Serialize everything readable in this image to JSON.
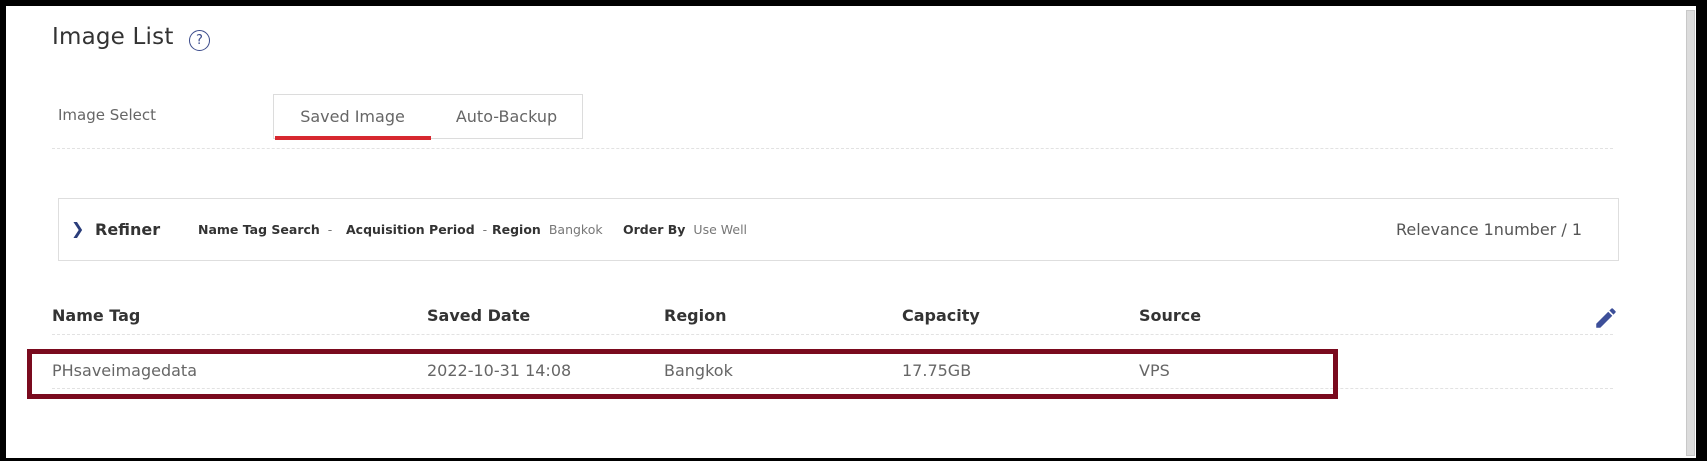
{
  "page": {
    "title": "Image List",
    "help_glyph": "?"
  },
  "image_select": {
    "label": "Image Select",
    "tabs": [
      {
        "label": "Saved Image",
        "active": true
      },
      {
        "label": "Auto-Backup",
        "active": false
      }
    ]
  },
  "refiner": {
    "toggle_glyph": "❯",
    "label": "Refiner",
    "filters": [
      {
        "label": "Name Tag Search",
        "value": "-"
      },
      {
        "label": "Acquisition Period",
        "value": "-"
      },
      {
        "label": "Region",
        "value": "Bangkok"
      },
      {
        "label": "Order By",
        "value": "Use Well"
      }
    ],
    "relevance": "Relevance 1number / 1"
  },
  "table": {
    "columns": [
      "Name Tag",
      "Saved Date",
      "Region",
      "Capacity",
      "Source"
    ],
    "rows": [
      [
        "PHsaveimagedata",
        "2022-10-31 14:08",
        "Bangkok",
        "17.75GB",
        "VPS"
      ]
    ],
    "edit_icon": "pencil-icon"
  },
  "colors": {
    "active_tab_underline": "#d7282f",
    "highlight_border": "#7a0a1e",
    "accent": "#2a3d7a"
  }
}
